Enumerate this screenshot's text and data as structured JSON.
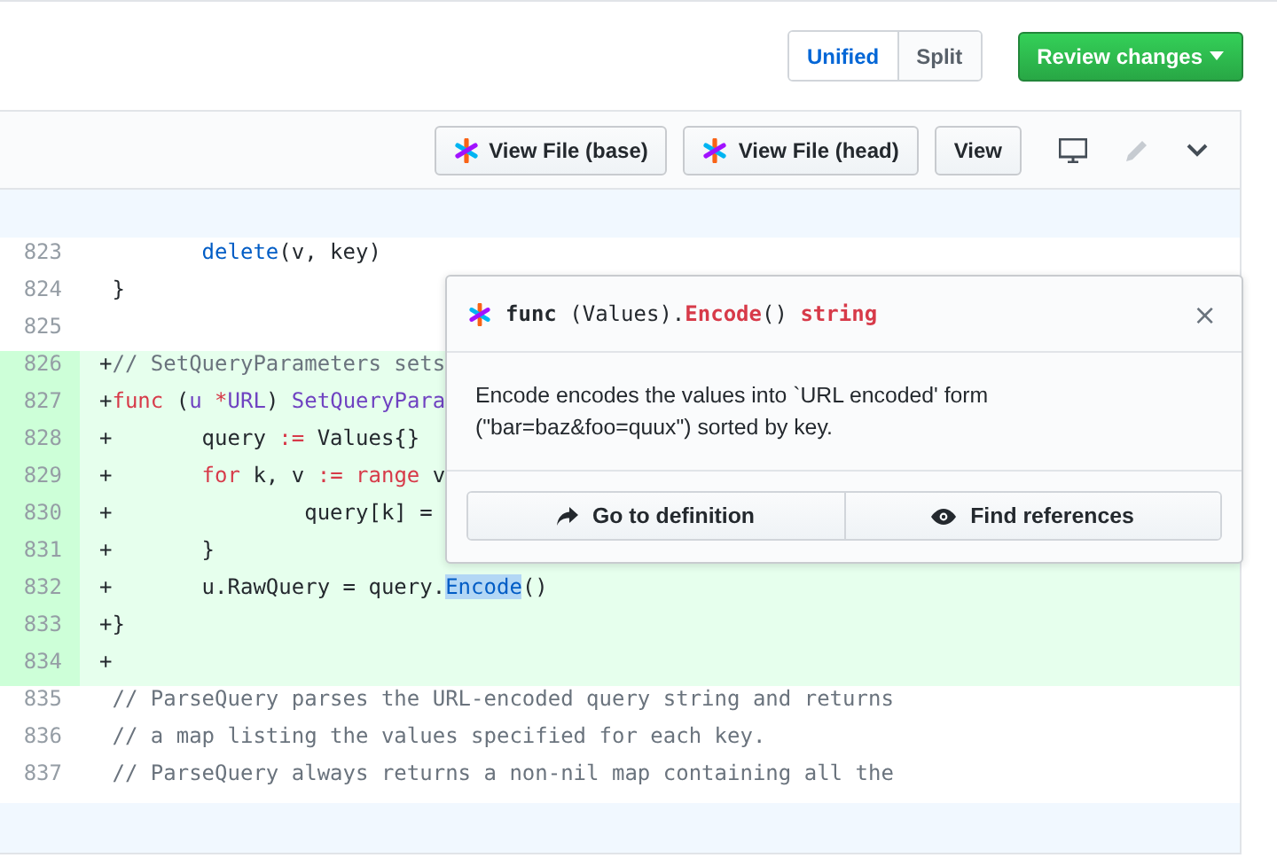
{
  "view_toggle": [
    {
      "label": "Unified",
      "selected": true
    },
    {
      "label": "Split",
      "selected": false
    }
  ],
  "review_button": {
    "label": "Review changes"
  },
  "file_header": {
    "buttons": [
      {
        "label": "View File (base)",
        "kind": "logo"
      },
      {
        "label": "View File (head)",
        "kind": "logo"
      },
      {
        "label": "View",
        "kind": "plain"
      }
    ]
  },
  "diff_lines": [
    {
      "number": "823",
      "added": false,
      "tokens": [
        {
          "t": "        delete",
          "kind": "builtin"
        },
        {
          "t": "(v, key)",
          "kind": "plain"
        }
      ]
    },
    {
      "number": "824",
      "added": false,
      "tokens": [
        {
          "t": " }",
          "kind": "plain"
        }
      ]
    },
    {
      "number": "825",
      "added": false
    },
    {
      "number": "826",
      "added": true,
      "tokens": [
        {
          "t": "+",
          "kind": "plain"
        },
        {
          "t": "// SetQueryParameters sets",
          "kind": "comment"
        }
      ]
    },
    {
      "number": "827",
      "added": true,
      "tokens": [
        {
          "t": "+",
          "kind": "plain"
        },
        {
          "t": "func",
          "kind": "keyword"
        },
        {
          "t": " (",
          "kind": "plain"
        },
        {
          "t": "u",
          "kind": "type"
        },
        {
          "t": " *",
          "kind": "keyword"
        },
        {
          "t": "URL",
          "kind": "type"
        },
        {
          "t": ") ",
          "kind": "plain"
        },
        {
          "t": "SetQueryPara",
          "kind": "type"
        }
      ]
    },
    {
      "number": "828",
      "added": true,
      "tokens": [
        {
          "t": "+       query ",
          "kind": "plain"
        },
        {
          "t": ":=",
          "kind": "keyword"
        },
        {
          "t": " Values{}",
          "kind": "plain"
        }
      ]
    },
    {
      "number": "829",
      "added": true,
      "tokens": [
        {
          "t": "+",
          "kind": "plain"
        },
        {
          "t": "       for",
          "kind": "keyword"
        },
        {
          "t": " k, v ",
          "kind": "plain"
        },
        {
          "t": ":= range",
          "kind": "keyword"
        },
        {
          "t": " v",
          "kind": "plain"
        }
      ]
    },
    {
      "number": "830",
      "added": true,
      "tokens": [
        {
          "t": "+               query[k] =",
          "kind": "plain"
        }
      ]
    },
    {
      "number": "831",
      "added": true,
      "tokens": [
        {
          "t": "+       }",
          "kind": "plain"
        }
      ]
    },
    {
      "number": "832",
      "added": true,
      "tokens": [
        {
          "t": "+       u.RawQuery = query.",
          "kind": "plain"
        },
        {
          "t": "Encode",
          "kind": "match"
        },
        {
          "t": "()",
          "kind": "plain"
        }
      ]
    },
    {
      "number": "833",
      "added": true,
      "tokens": [
        {
          "t": "+}",
          "kind": "plain"
        }
      ]
    },
    {
      "number": "834",
      "added": true,
      "tokens": [
        {
          "t": "+",
          "kind": "plain"
        }
      ]
    },
    {
      "number": "835",
      "added": false,
      "tokens": [
        {
          "t": " // ParseQuery parses the URL-encoded query string and returns",
          "kind": "comment"
        }
      ]
    },
    {
      "number": "836",
      "added": false,
      "tokens": [
        {
          "t": " // a map listing the values specified for each key.",
          "kind": "comment"
        }
      ]
    },
    {
      "number": "837",
      "added": false,
      "tokens": [
        {
          "t": " // ParseQuery always returns a non-nil map containing all the",
          "kind": "comment"
        }
      ]
    }
  ],
  "hover_card": {
    "signature": [
      {
        "t": "func",
        "kind": "bold"
      },
      {
        "t": " (Values).",
        "kind": "plain"
      },
      {
        "t": "Encode",
        "kind": "keyword"
      },
      {
        "t": "() ",
        "kind": "plain"
      },
      {
        "t": "string",
        "kind": "keyword"
      }
    ],
    "close": "×",
    "description": "Encode encodes the values into `URL encoded' form (\"bar=baz&foo=quux\") sorted by key.",
    "actions": [
      {
        "label": "Go to definition",
        "kind": "definition"
      },
      {
        "label": "Find references",
        "kind": "references"
      }
    ]
  }
}
